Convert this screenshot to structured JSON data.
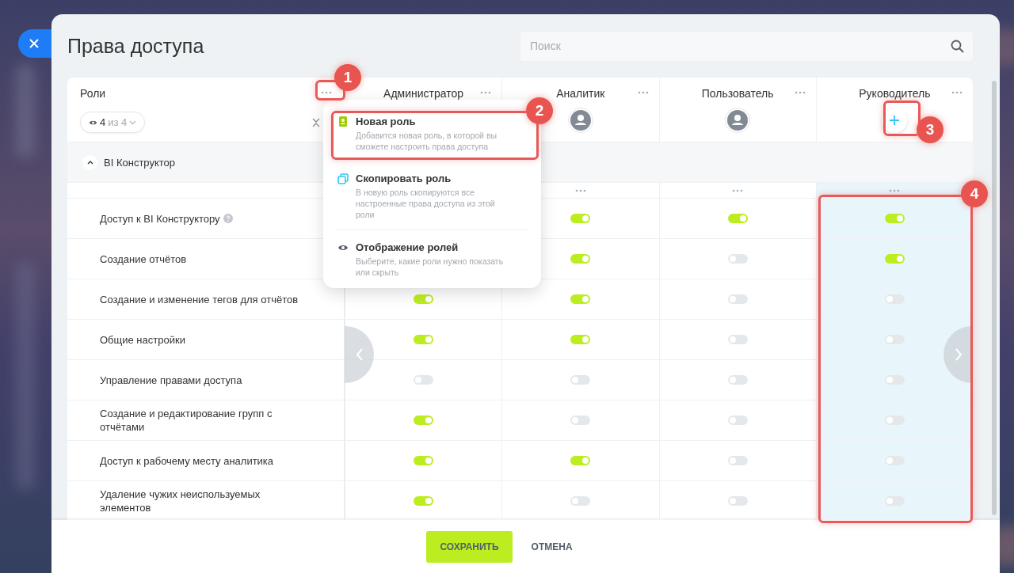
{
  "title": "Права доступа",
  "search": {
    "placeholder": "Поиск"
  },
  "roles_header": {
    "label": "Роли",
    "visible": "4",
    "total": "из 4"
  },
  "columns": [
    {
      "name": "Администратор",
      "highlighted": false
    },
    {
      "name": "Аналитик",
      "kind": "user",
      "highlighted": false
    },
    {
      "name": "Пользователь",
      "kind": "user",
      "highlighted": false
    },
    {
      "name": "Руководитель",
      "kind": "add",
      "highlighted": true
    }
  ],
  "section": {
    "label": "BI Конструктор",
    "expanded": true
  },
  "rows": [
    {
      "label": "Доступ к BI Конструктору",
      "hint": true,
      "cells": [
        {},
        {
          "on": true
        },
        {
          "on": true
        },
        {
          "on": true
        }
      ]
    },
    {
      "label": "Создание отчётов",
      "hint": false,
      "cells": [
        {},
        {
          "on": true
        },
        {
          "on": false
        },
        {
          "on": true
        }
      ]
    },
    {
      "label": "Создание и изменение тегов для отчётов",
      "hint": false,
      "cells": [
        {
          "on": true
        },
        {
          "on": true
        },
        {
          "on": false
        },
        {
          "on": false
        }
      ]
    },
    {
      "label": "Общие настройки",
      "hint": false,
      "cells": [
        {
          "on": true
        },
        {
          "on": true
        },
        {
          "on": false
        },
        {
          "on": false
        }
      ]
    },
    {
      "label": "Управление правами доступа",
      "hint": false,
      "cells": [
        {
          "on": false
        },
        {
          "on": false
        },
        {
          "on": false
        },
        {
          "on": false
        }
      ]
    },
    {
      "label": "Создание и редактирование групп с отчётами",
      "hint": false,
      "cells": [
        {
          "on": true
        },
        {
          "on": false
        },
        {
          "on": false
        },
        {
          "on": false
        }
      ]
    },
    {
      "label": "Доступ к рабочему месту аналитика",
      "hint": false,
      "cells": [
        {
          "on": true
        },
        {
          "on": true
        },
        {
          "on": false
        },
        {
          "on": false
        }
      ]
    },
    {
      "label": "Удаление чужих неиспользуемых элементов",
      "hint": false,
      "cells": [
        {
          "on": true
        },
        {
          "on": false
        },
        {
          "on": false
        },
        {
          "on": false
        }
      ]
    }
  ],
  "menu": {
    "items": [
      {
        "kind": "new",
        "title": "Новая роль",
        "description": "Добавится новая роль, в которой вы сможете настроить права доступа"
      },
      {
        "kind": "copy",
        "title": "Скопировать роль",
        "description": "В новую роль скопируются все настроенные права доступа из этой роли"
      },
      {
        "kind": "view",
        "title": "Отображение ролей",
        "description": "Выберите, какие роли нужно показать или скрыть"
      }
    ]
  },
  "annotations": [
    {
      "number": "1"
    },
    {
      "number": "2"
    },
    {
      "number": "3"
    },
    {
      "number": "4"
    }
  ],
  "footer": {
    "save": "СОХРАНИТЬ",
    "cancel": "ОТМЕНА"
  }
}
